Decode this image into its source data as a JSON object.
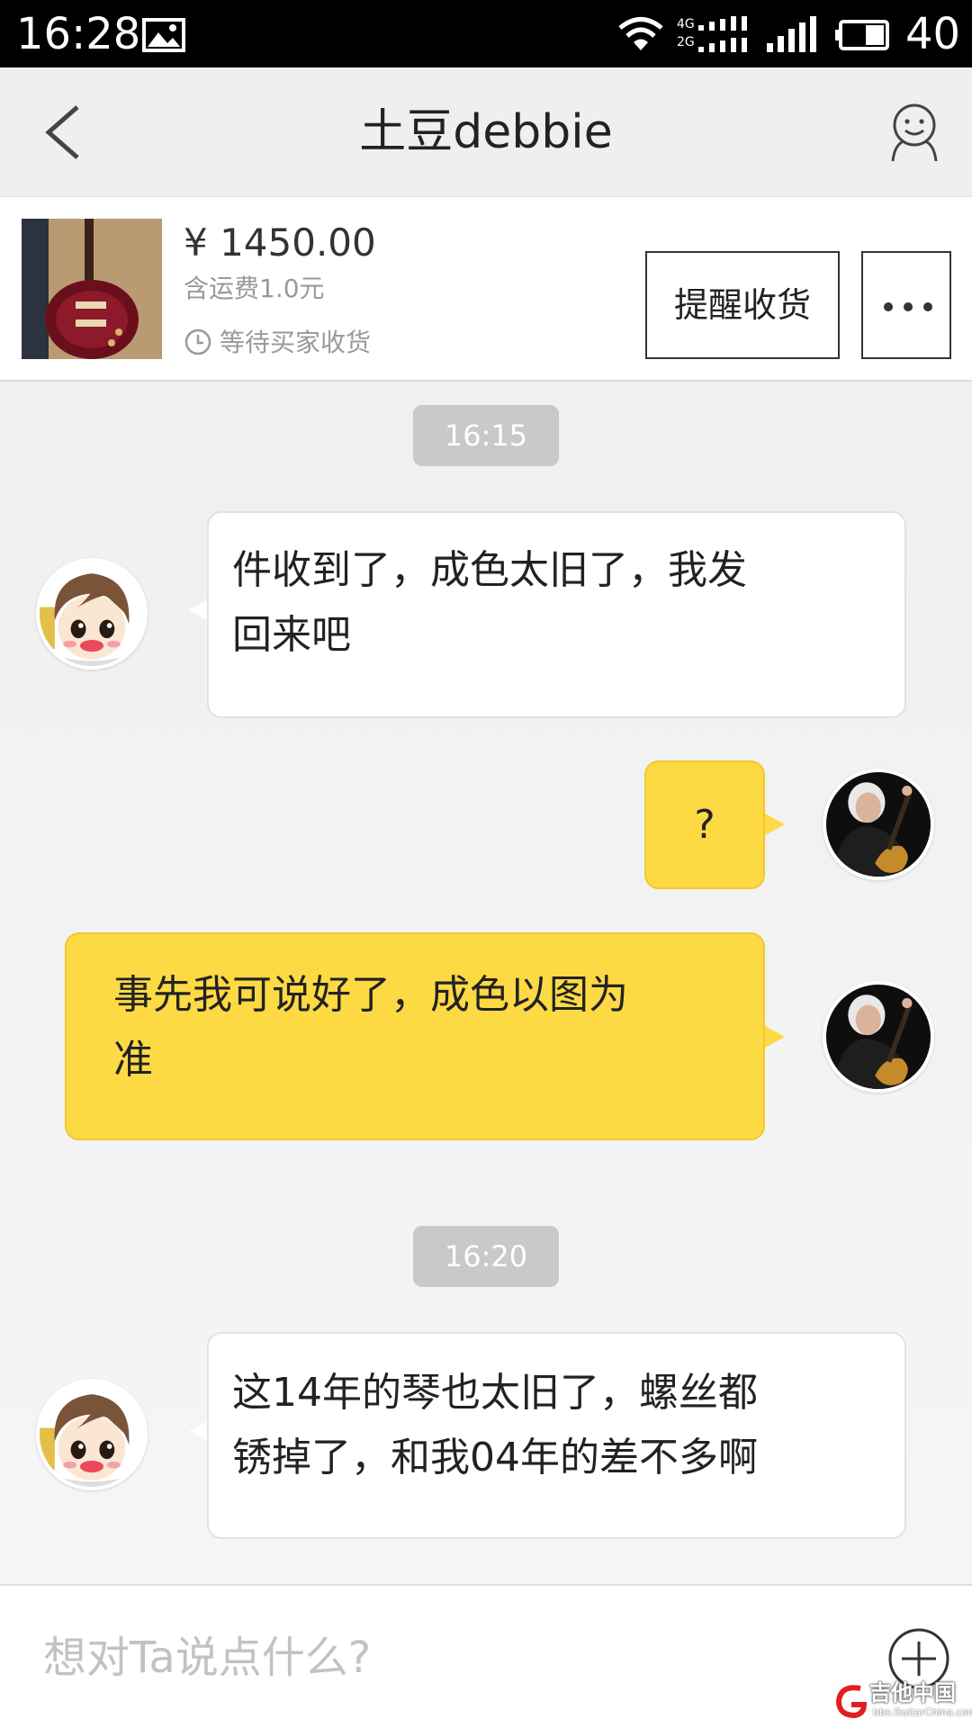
{
  "status_bar": {
    "time": "16:28",
    "network_4g": "4G",
    "network_2g": "2G",
    "battery": "40",
    "icons": [
      "image-icon",
      "wifi-icon",
      "signal-icon",
      "battery-icon"
    ]
  },
  "header": {
    "title": "土豆debbie",
    "back_icon": "chevron-left-icon",
    "profile_icon": "smiley-person-icon"
  },
  "order": {
    "price": "¥ 1450.00",
    "shipping": "含运费1.0元",
    "status": "等待买家收货",
    "remind_button": "提醒收货",
    "more_button_icon": "more-dots-icon"
  },
  "messages": [
    {
      "type": "timestamp",
      "text": "16:15"
    },
    {
      "type": "incoming",
      "text": "件收到了，成色太旧了，我发\n回来吧"
    },
    {
      "type": "outgoing",
      "text": "?"
    },
    {
      "type": "outgoing",
      "text": "事先我可说好了，成色以图为\n准"
    },
    {
      "type": "timestamp",
      "text": "16:20"
    },
    {
      "type": "incoming",
      "text": "这14年的琴也太旧了，螺丝都\n锈掉了，和我04年的差不多啊"
    }
  ],
  "input": {
    "placeholder": "想对Ta说点什么?",
    "add_icon": "plus-circle-icon"
  },
  "watermark": {
    "text": "吉他中国",
    "sub": "bbs.GuitarChina.com"
  },
  "colors": {
    "outgoing_bubble": "#fdda44",
    "incoming_bubble": "#ffffff",
    "timestamp_bg": "#c9c9c9"
  }
}
